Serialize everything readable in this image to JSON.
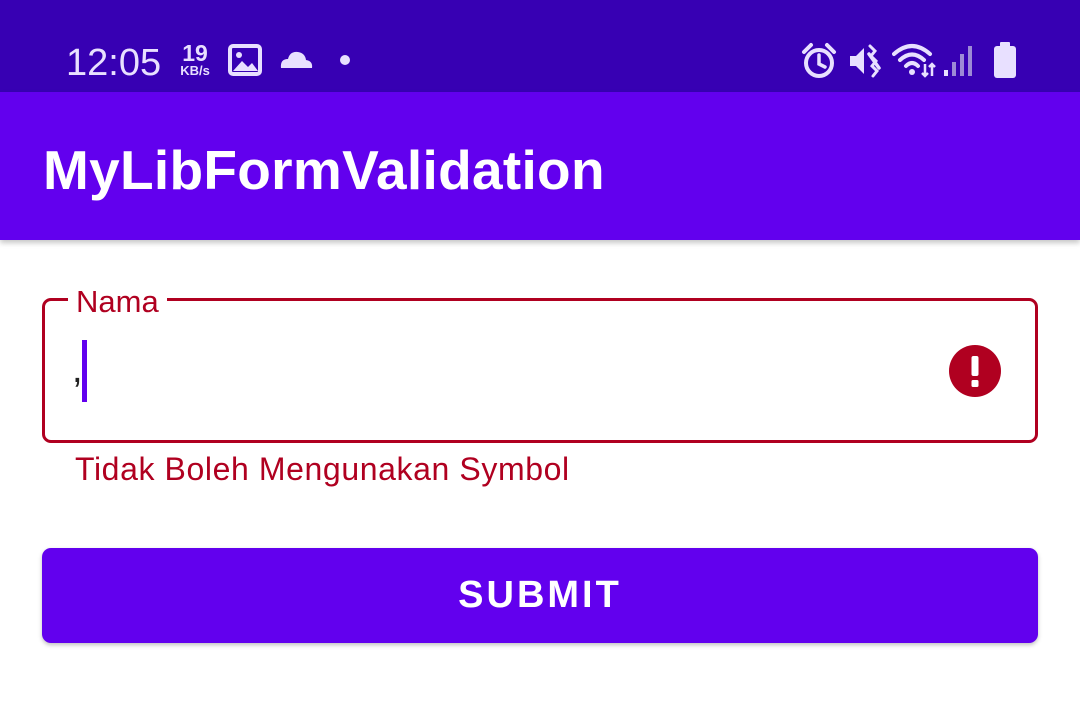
{
  "status_bar": {
    "time": "12:05",
    "net_speed_value": "19",
    "net_speed_unit": "KB/s",
    "left_icons": [
      "image-icon",
      "cloud-icon",
      "notification-dot-icon"
    ],
    "right_icons": [
      "alarm-icon",
      "vibrate-mute-icon",
      "wifi-icon",
      "signal-icon",
      "battery-icon"
    ]
  },
  "app_bar": {
    "title": "MyLibFormValidation"
  },
  "form": {
    "name_field": {
      "label": "Nama",
      "value": ",",
      "error_message": "Tidak Boleh Mengunakan Symbol",
      "error_icon": "error-icon"
    },
    "submit_label": "SUBMIT"
  },
  "colors": {
    "status_bar": "#3700b3",
    "primary": "#6200ee",
    "error": "#b00020",
    "background": "#ffffff"
  }
}
